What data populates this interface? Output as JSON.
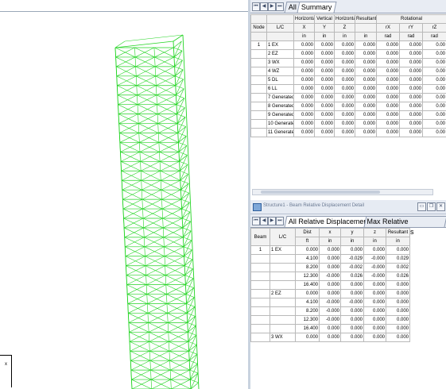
{
  "viewport": {
    "axis_label": "x",
    "colors": {
      "structure": "#22d422",
      "member": "#d61f1f"
    }
  },
  "summary_panel": {
    "nav_icons": [
      "first-icon",
      "prev-icon",
      "next-icon",
      "last-icon"
    ],
    "nav_glyphs": [
      "⏮",
      "◀",
      "▶",
      "⏭"
    ],
    "tabs": [
      {
        "label": "All"
      },
      {
        "label": "Summary"
      }
    ],
    "header_group": [
      "",
      "",
      "Horizontal",
      "Vertical",
      "Horizontal",
      "Resultant",
      "Rotational"
    ],
    "columns": [
      "Node",
      "L/C",
      "X",
      "Y",
      "Z",
      "",
      "rX",
      "rY",
      "rZ"
    ],
    "units": [
      "",
      "",
      "in",
      "in",
      "in",
      "in",
      "rad",
      "rad",
      "rad"
    ],
    "rows": [
      [
        "1",
        "1 EX",
        "0.000",
        "0.000",
        "0.000",
        "0.000",
        "0.000",
        "0.000",
        "0.00"
      ],
      [
        "",
        "2 EZ",
        "0.000",
        "0.000",
        "0.000",
        "0.000",
        "0.000",
        "0.000",
        "0.00"
      ],
      [
        "",
        "3 WX",
        "0.000",
        "0.000",
        "0.000",
        "0.000",
        "0.000",
        "0.000",
        "0.00"
      ],
      [
        "",
        "4 WZ",
        "0.000",
        "0.000",
        "0.000",
        "0.000",
        "0.000",
        "0.000",
        "0.00"
      ],
      [
        "",
        "5 DL",
        "0.000",
        "0.000",
        "0.000",
        "0.000",
        "0.000",
        "0.000",
        "0.00"
      ],
      [
        "",
        "6 LL",
        "0.000",
        "0.000",
        "0.000",
        "0.000",
        "0.000",
        "0.000",
        "0.00"
      ],
      [
        "",
        "7 Generated",
        "0.000",
        "0.000",
        "0.000",
        "0.000",
        "0.000",
        "0.000",
        "0.00"
      ],
      [
        "",
        "8 Generated",
        "0.000",
        "0.000",
        "0.000",
        "0.000",
        "0.000",
        "0.000",
        "0.00"
      ],
      [
        "",
        "9 Generated",
        "0.000",
        "0.000",
        "0.000",
        "0.000",
        "0.000",
        "0.000",
        "0.00"
      ],
      [
        "",
        "10 Generate",
        "0.000",
        "0.000",
        "0.000",
        "0.000",
        "0.000",
        "0.000",
        "0.00"
      ],
      [
        "",
        "11 Generate",
        "0.000",
        "0.000",
        "0.000",
        "0.000",
        "0.000",
        "0.000",
        "0.00"
      ]
    ]
  },
  "beam_panel": {
    "title": "Structure1 - Beam Relative Displacement Detail",
    "window_icons": [
      "minimize-icon",
      "restore-icon",
      "close-icon"
    ],
    "window_glyphs": [
      "▭",
      "❐",
      "✕"
    ],
    "nav_icons": [
      "first-icon",
      "prev-icon",
      "next-icon",
      "last-icon"
    ],
    "nav_glyphs": [
      "⏮",
      "◀",
      "▶",
      "⏭"
    ],
    "tabs": [
      {
        "label": "All Relative Displacement"
      },
      {
        "label": "Max Relative Displacements"
      }
    ],
    "columns": [
      "Beam",
      "L/C",
      "Dist",
      "x",
      "y",
      "z",
      "Resultant"
    ],
    "units": [
      "",
      "",
      "ft",
      "in",
      "in",
      "in",
      "in"
    ],
    "rows": [
      [
        "1",
        "1 EX",
        "0.000",
        "0.000",
        "0.000",
        "0.000",
        "0.000"
      ],
      [
        "",
        "",
        "4.100",
        "0.000",
        "-0.029",
        "-0.000",
        "0.029"
      ],
      [
        "",
        "",
        "8.200",
        "0.000",
        "-0.002",
        "-0.000",
        "0.002"
      ],
      [
        "",
        "",
        "12.300",
        "-0.000",
        "0.026",
        "-0.000",
        "0.026"
      ],
      [
        "",
        "",
        "16.400",
        "0.000",
        "0.000",
        "0.000",
        "0.000"
      ],
      [
        "",
        "2 EZ",
        "0.000",
        "0.000",
        "0.000",
        "0.000",
        "0.000"
      ],
      [
        "",
        "",
        "4.100",
        "-0.000",
        "-0.000",
        "0.000",
        "0.000"
      ],
      [
        "",
        "",
        "8.200",
        "-0.000",
        "0.000",
        "0.000",
        "0.000"
      ],
      [
        "",
        "",
        "12.300",
        "-0.000",
        "0.000",
        "0.000",
        "0.000"
      ],
      [
        "",
        "",
        "16.400",
        "0.000",
        "0.000",
        "0.000",
        "0.000"
      ],
      [
        "",
        "3 WX",
        "0.000",
        "0.000",
        "0.000",
        "0.000",
        "0.000"
      ]
    ]
  }
}
